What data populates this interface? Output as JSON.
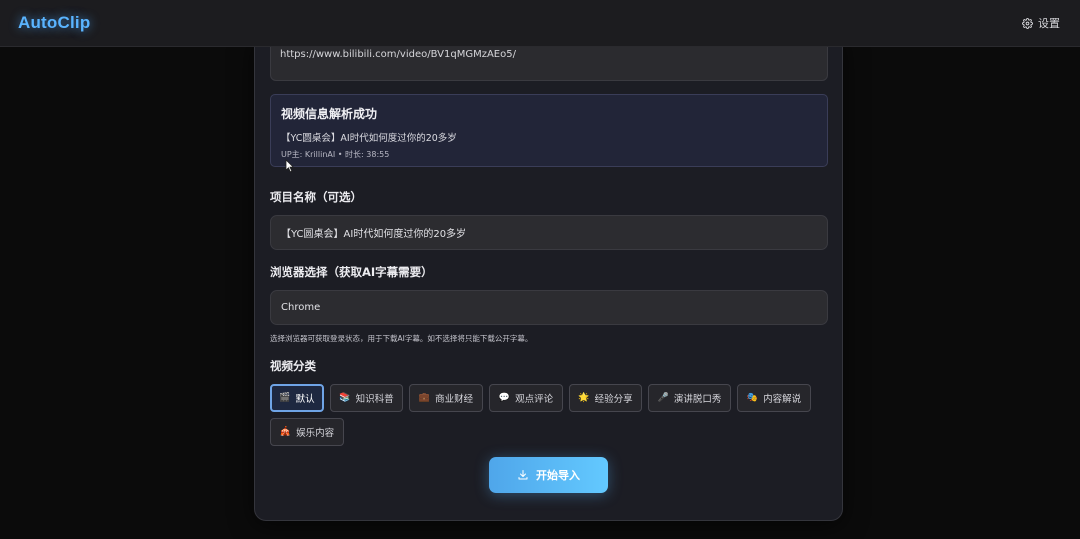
{
  "app": {
    "title": "AutoClip"
  },
  "header": {
    "settings_label": "设置"
  },
  "form": {
    "url_value": "https://www.bilibili.com/video/BV1qMGMzAEo5/",
    "parse_result": {
      "title": "视频信息解析成功",
      "video_title": "【YC圆桌会】AI时代如何度过你的20多岁",
      "meta": "UP主: KrillinAI • 时长: 38:55"
    },
    "project_name_label": "项目名称（可选）",
    "project_name_value": "【YC圆桌会】AI时代如何度过你的20多岁",
    "browser_label": "浏览器选择（获取AI字幕需要）",
    "browser_value": "Chrome",
    "browser_hint": "选择浏览器可获取登录状态，用于下载AI字幕。如不选择将只能下载公开字幕。",
    "category_label": "视频分类",
    "categories": [
      {
        "label": "默认",
        "icon": "🎬",
        "icon_name": "clapper-icon"
      },
      {
        "label": "知识科普",
        "icon": "📚",
        "icon_name": "books-icon"
      },
      {
        "label": "商业财经",
        "icon": "💼",
        "icon_name": "briefcase-icon"
      },
      {
        "label": "观点评论",
        "icon": "💬",
        "icon_name": "speech-bubble-icon"
      },
      {
        "label": "经验分享",
        "icon": "🌟",
        "icon_name": "star-icon"
      },
      {
        "label": "演讲脱口秀",
        "icon": "🎤",
        "icon_name": "microphone-icon"
      },
      {
        "label": "内容解说",
        "icon": "🎭",
        "icon_name": "theater-masks-icon"
      },
      {
        "label": "娱乐内容",
        "icon": "🎪",
        "icon_name": "circus-tent-icon"
      }
    ],
    "selected_category": "默认",
    "submit_label": "开始导入"
  },
  "colors": {
    "accent": "#5ab4ff",
    "button_gradient_start": "#4fa6ea",
    "button_gradient_end": "#63c9ff",
    "active_border": "#6fa4e6"
  }
}
